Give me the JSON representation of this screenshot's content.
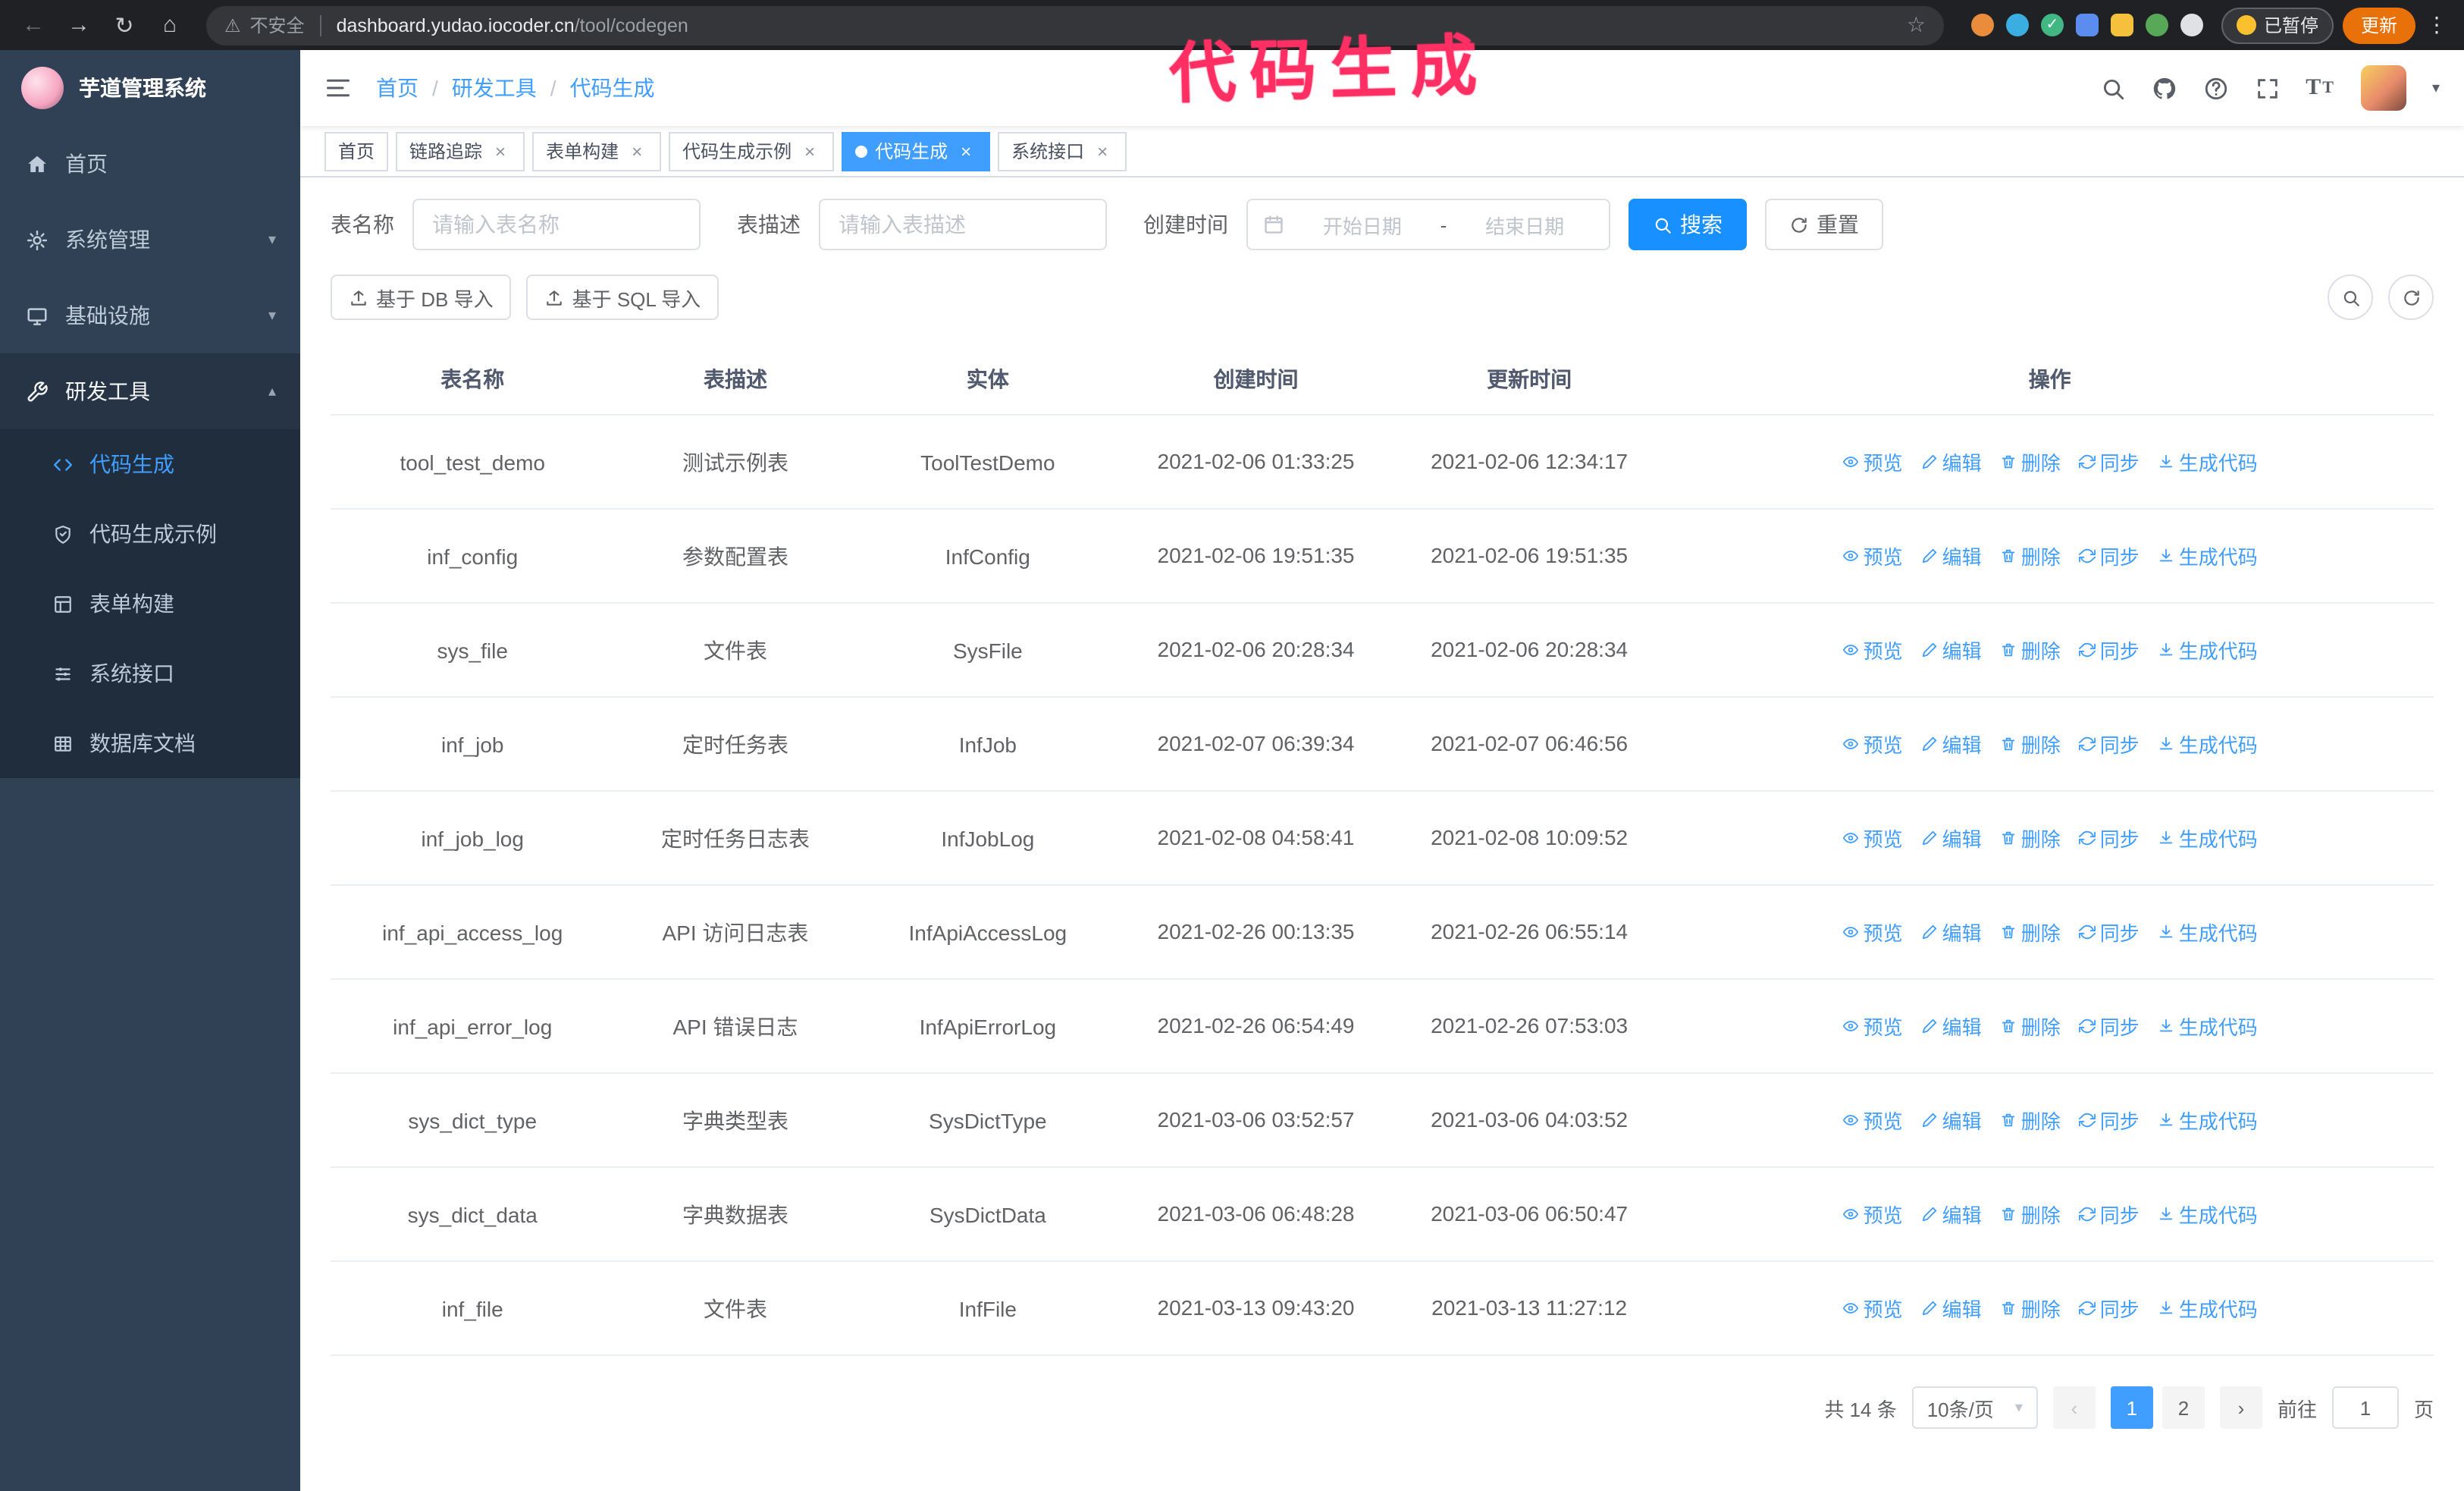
{
  "browser": {
    "warning": "不安全",
    "url_host": "dashboard.yudao.iocoder.cn",
    "url_path": "/tool/codegen",
    "paused_badge": "已暂停",
    "update_button": "更新"
  },
  "annotation": {
    "text": "代码生成",
    "color": "#ff2e63"
  },
  "theme": {
    "accent_blue": "#409eff",
    "search_button_blue": "#1890ff",
    "sidebar_bg": "#304156",
    "submenu_bg": "#1f2d3d",
    "active_tab_bg": "#409eff",
    "annotation_pink": "#ff2e63"
  },
  "sidebar": {
    "title": "芋道管理系统",
    "menu": [
      {
        "label": "首页",
        "icon": "home-icon"
      },
      {
        "label": "系统管理",
        "icon": "gear-icon",
        "expand": "down"
      },
      {
        "label": "基础设施",
        "icon": "monitor-icon",
        "expand": "down"
      },
      {
        "label": "研发工具",
        "icon": "tools-icon",
        "expand": "up"
      }
    ],
    "submenu": [
      {
        "label": "代码生成",
        "icon": "code-icon",
        "active": true
      },
      {
        "label": "代码生成示例",
        "icon": "shield-icon",
        "active": false
      },
      {
        "label": "表单构建",
        "icon": "form-icon",
        "active": false
      },
      {
        "label": "系统接口",
        "icon": "api-icon",
        "active": false
      },
      {
        "label": "数据库文档",
        "icon": "table-icon",
        "active": false
      }
    ]
  },
  "navbar": {
    "breadcrumb": [
      "首页",
      "研发工具",
      "代码生成"
    ]
  },
  "tabs": [
    {
      "label": "首页",
      "closable": false,
      "active": false
    },
    {
      "label": "链路追踪",
      "closable": true,
      "active": false
    },
    {
      "label": "表单构建",
      "closable": true,
      "active": false
    },
    {
      "label": "代码生成示例",
      "closable": true,
      "active": false
    },
    {
      "label": "代码生成",
      "closable": true,
      "active": true
    },
    {
      "label": "系统接口",
      "closable": true,
      "active": false
    }
  ],
  "filters": {
    "name_label": "表名称",
    "name_placeholder": "请输入表名称",
    "desc_label": "表描述",
    "desc_placeholder": "请输入表描述",
    "time_label": "创建时间",
    "start_placeholder": "开始日期",
    "range_separator": "-",
    "end_placeholder": "结束日期",
    "search": "搜索",
    "reset": "重置"
  },
  "toolbar": {
    "import_db": "基于 DB 导入",
    "import_sql": "基于 SQL 导入"
  },
  "table": {
    "columns": [
      "表名称",
      "表描述",
      "实体",
      "创建时间",
      "更新时间",
      "操作"
    ],
    "actions": [
      {
        "label": "预览",
        "icon": "eye-icon"
      },
      {
        "label": "编辑",
        "icon": "edit-icon"
      },
      {
        "label": "删除",
        "icon": "delete-icon"
      },
      {
        "label": "同步",
        "icon": "sync-icon"
      },
      {
        "label": "生成代码",
        "icon": "download-icon"
      }
    ],
    "rows": [
      {
        "name": "tool_test_demo",
        "desc": "测试示例表",
        "entity": "ToolTestDemo",
        "created": "2021-02-06 01:33:25",
        "updated": "2021-02-06 12:34:17"
      },
      {
        "name": "inf_config",
        "desc": "参数配置表",
        "entity": "InfConfig",
        "created": "2021-02-06 19:51:35",
        "updated": "2021-02-06 19:51:35"
      },
      {
        "name": "sys_file",
        "desc": "文件表",
        "entity": "SysFile",
        "created": "2021-02-06 20:28:34",
        "updated": "2021-02-06 20:28:34"
      },
      {
        "name": "inf_job",
        "desc": "定时任务表",
        "entity": "InfJob",
        "created": "2021-02-07 06:39:34",
        "updated": "2021-02-07 06:46:56"
      },
      {
        "name": "inf_job_log",
        "desc": "定时任务日志表",
        "entity": "InfJobLog",
        "created": "2021-02-08 04:58:41",
        "updated": "2021-02-08 10:09:52"
      },
      {
        "name": "inf_api_access_log",
        "desc": "API 访问日志表",
        "entity": "InfApiAccessLog",
        "created": "2021-02-26 00:13:35",
        "updated": "2021-02-26 06:55:14"
      },
      {
        "name": "inf_api_error_log",
        "desc": "API 错误日志",
        "entity": "InfApiErrorLog",
        "created": "2021-02-26 06:54:49",
        "updated": "2021-02-26 07:53:03"
      },
      {
        "name": "sys_dict_type",
        "desc": "字典类型表",
        "entity": "SysDictType",
        "created": "2021-03-06 03:52:57",
        "updated": "2021-03-06 04:03:52"
      },
      {
        "name": "sys_dict_data",
        "desc": "字典数据表",
        "entity": "SysDictData",
        "created": "2021-03-06 06:48:28",
        "updated": "2021-03-06 06:50:47"
      },
      {
        "name": "inf_file",
        "desc": "文件表",
        "entity": "InfFile",
        "created": "2021-03-13 09:43:20",
        "updated": "2021-03-13 11:27:12"
      }
    ]
  },
  "pagination": {
    "total": "共 14 条",
    "page_size": "10条/页",
    "pages": [
      "1",
      "2"
    ],
    "active_page": "1",
    "goto_label": "前往",
    "goto_value": "1",
    "goto_suffix": "页"
  }
}
